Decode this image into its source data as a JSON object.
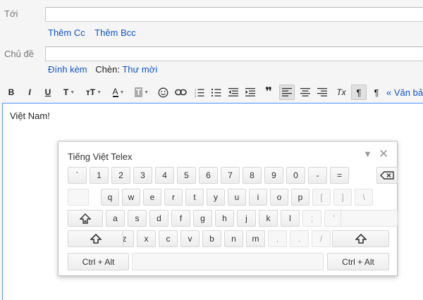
{
  "compose": {
    "to_label": "Tới",
    "cc_link": "Thêm Cc",
    "bcc_link": "Thêm Bcc",
    "subject_label": "Chủ đề",
    "attach_link": "Đính kèm",
    "insert_label": "Chèn:",
    "invitation_link": "Thư mời",
    "body_text": "Việt Nam!",
    "plain_text_link": "« Văn bản"
  },
  "toolbar": {
    "bold": "B",
    "italic": "I",
    "underline": "U",
    "font": "T",
    "size": "тT",
    "text_color": "A",
    "highlight": "T",
    "quote": "❞",
    "clear_format": "Tx",
    "paragraph": "¶"
  },
  "keyboard": {
    "title": "Tiếng Việt Telex",
    "row1": [
      "`",
      "1",
      "2",
      "3",
      "4",
      "5",
      "6",
      "7",
      "8",
      "9",
      "0",
      "-",
      "="
    ],
    "row2": [
      "q",
      "w",
      "e",
      "r",
      "t",
      "y",
      "u",
      "i",
      "o",
      "p",
      "[",
      "]",
      "\\"
    ],
    "row3": [
      "a",
      "s",
      "d",
      "f",
      "g",
      "h",
      "j",
      "k",
      "l",
      ";",
      "'"
    ],
    "row4": [
      "z",
      "x",
      "c",
      "v",
      "b",
      "n",
      "m",
      ",",
      ".",
      "/"
    ],
    "ctrl_alt_left": "Ctrl + Alt",
    "ctrl_alt_right": "Ctrl + Alt",
    "icons": {
      "backspace": "backspace-icon",
      "caps": "caps-lock-icon",
      "shift": "shift-icon",
      "minimize": "triangle-down-icon",
      "close": "close-icon"
    }
  }
}
